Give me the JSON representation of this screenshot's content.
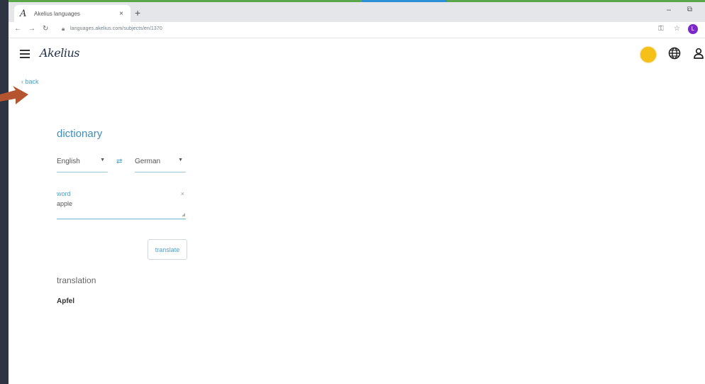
{
  "browser": {
    "tab_title": "Akelius languages",
    "tab_close": "×",
    "new_tab": "+",
    "url": "languages.akelius.com/subjects/en/1370",
    "win_min": "–",
    "win_max": "⧉",
    "profile_initial": "L"
  },
  "app": {
    "logo": "Akelius",
    "back_label": "‹  back"
  },
  "dictionary": {
    "title": "dictionary",
    "source_language": "English",
    "target_language": "German",
    "swap_icon": "⇄",
    "word_label": "word",
    "word_value": "apple",
    "clear_icon": "×",
    "translate_button": "translate",
    "translation_label": "translation",
    "translation_value": "Apfel"
  },
  "colors": {
    "accent": "#3b8fbf",
    "sun": "#f5c018",
    "arrow": "#b5552f",
    "profile": "#7a28c8"
  }
}
